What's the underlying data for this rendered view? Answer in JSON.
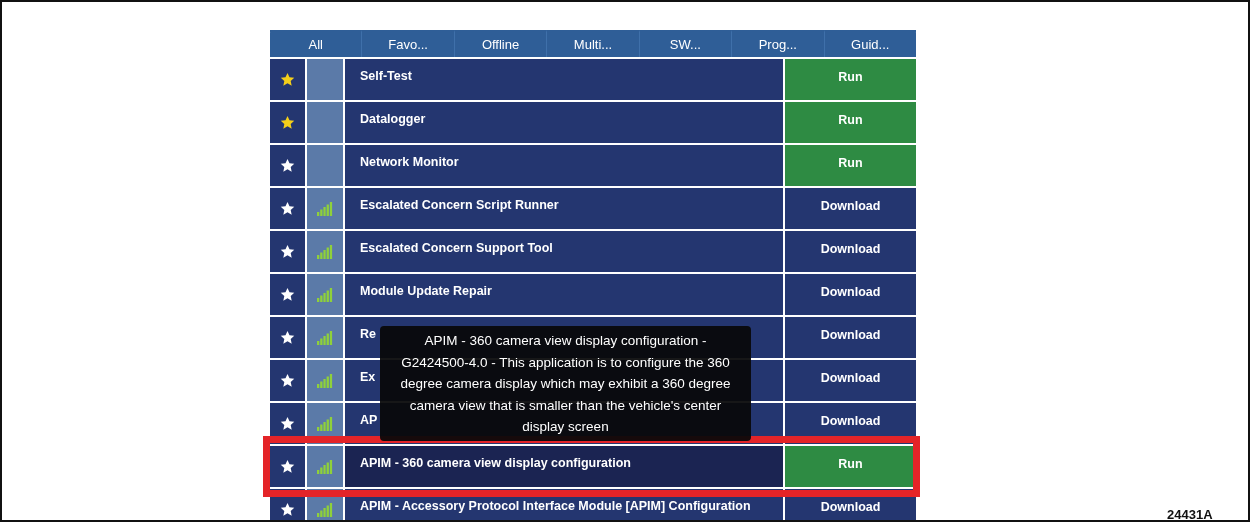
{
  "tabs": [
    {
      "label": "All"
    },
    {
      "label": "Favo..."
    },
    {
      "label": "Offline"
    },
    {
      "label": "Multi..."
    },
    {
      "label": "SW..."
    },
    {
      "label": "Prog..."
    },
    {
      "label": "Guid..."
    }
  ],
  "rows": [
    {
      "kind": "run",
      "favorite": true,
      "signal": false,
      "name": "Self-Test",
      "action": "Run",
      "highlighted": false
    },
    {
      "kind": "run",
      "favorite": true,
      "signal": false,
      "name": "Datalogger",
      "action": "Run",
      "highlighted": false
    },
    {
      "kind": "run",
      "favorite": false,
      "signal": false,
      "name": "Network Monitor",
      "action": "Run",
      "highlighted": false
    },
    {
      "kind": "download",
      "favorite": false,
      "signal": true,
      "name": "Escalated Concern Script Runner",
      "action": "Download",
      "highlighted": false
    },
    {
      "kind": "download",
      "favorite": false,
      "signal": true,
      "name": "Escalated Concern Support Tool",
      "action": "Download",
      "highlighted": false
    },
    {
      "kind": "download",
      "favorite": false,
      "signal": true,
      "name": "Module Update Repair",
      "action": "Download",
      "highlighted": false
    },
    {
      "kind": "download",
      "favorite": false,
      "signal": true,
      "name": "Re",
      "action": "Download",
      "highlighted": false
    },
    {
      "kind": "download",
      "favorite": false,
      "signal": true,
      "name": "Ex",
      "action": "Download",
      "highlighted": false
    },
    {
      "kind": "download",
      "favorite": false,
      "signal": true,
      "name": "AP",
      "action": "Download",
      "highlighted": false
    },
    {
      "kind": "run",
      "favorite": false,
      "signal": true,
      "name": "APIM - 360 camera view display configuration",
      "action": "Run",
      "highlighted": true
    },
    {
      "kind": "download",
      "favorite": false,
      "signal": true,
      "name": "APIM - Accessory Protocol Interface Module [APIM] Configuration",
      "action": "Download",
      "highlighted": false
    }
  ],
  "tooltip": "APIM - 360 camera view display configuration - G2424500-4.0 - This application is to configure the 360 degree camera display which may exhibit a 360 degree camera view that is smaller than the vehicle's center display screen",
  "figure_id": "24431A"
}
